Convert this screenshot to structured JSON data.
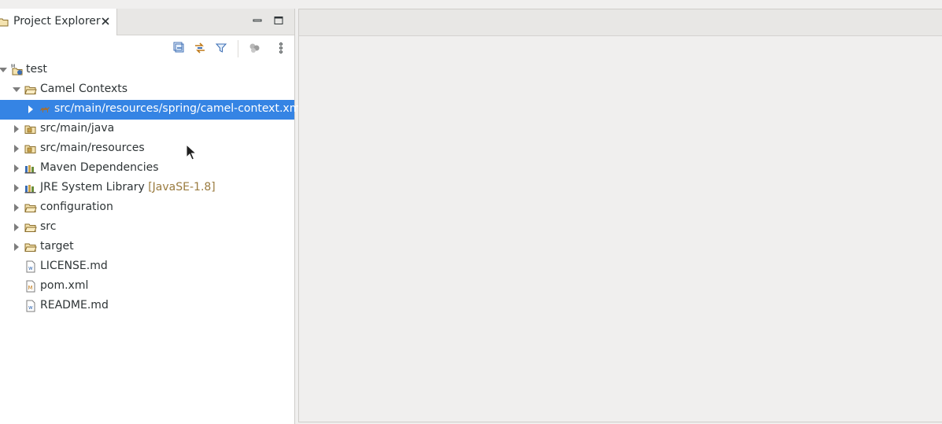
{
  "view": {
    "title": "Project Explorer",
    "close_icon": "close-icon",
    "minimize_icon": "minimize-icon",
    "maximize_icon": "maximize-icon"
  },
  "toolbar": {
    "items": [
      "collapse-all-icon",
      "link-with-editor-icon",
      "filter-icon",
      "group-icon",
      "view-menu-icon"
    ]
  },
  "tree": {
    "root": {
      "label": "test",
      "expanded": true,
      "icon": "maven-project-icon"
    },
    "camel_contexts": {
      "label": "Camel Contexts",
      "expanded": true,
      "icon": "folder-open-icon"
    },
    "camel_file": {
      "label": "src/main/resources/spring/camel-context.xml",
      "selected": true,
      "icon": "camel-icon"
    },
    "items": [
      {
        "label": "src/main/java",
        "icon": "source-folder-icon"
      },
      {
        "label": "src/main/resources",
        "icon": "source-folder-icon"
      },
      {
        "label": "Maven Dependencies",
        "icon": "library-icon"
      },
      {
        "label": "JRE System Library",
        "decoration": "[JavaSE-1.8]",
        "icon": "library-icon"
      },
      {
        "label": "configuration",
        "icon": "folder-icon"
      },
      {
        "label": "src",
        "icon": "folder-icon"
      },
      {
        "label": "target",
        "icon": "folder-icon"
      }
    ],
    "files": [
      {
        "label": "LICENSE.md",
        "icon": "text-file-icon"
      },
      {
        "label": "pom.xml",
        "icon": "maven-pom-icon"
      },
      {
        "label": "README.md",
        "icon": "text-file-icon"
      }
    ]
  },
  "colors": {
    "selection": "#3584e4",
    "decoration": "#9a7b3f"
  }
}
